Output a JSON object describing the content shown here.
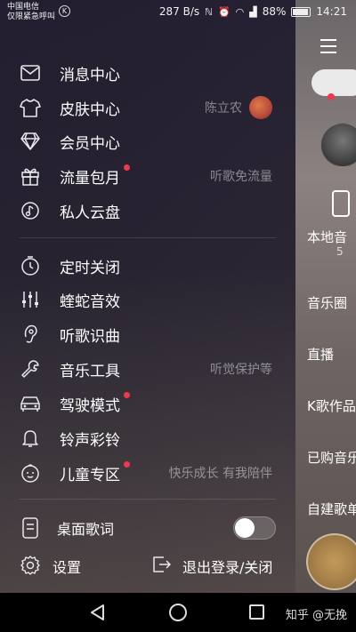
{
  "status_bar": {
    "carrier_line1": "中国电信",
    "carrier_line2": "仅限紧急呼叫",
    "carrier_badge": "K",
    "speed": "287 B/s",
    "battery": "88%",
    "time": "14:21"
  },
  "menu": {
    "items": [
      {
        "label": "消息中心",
        "icon": "mail-icon",
        "right": ""
      },
      {
        "label": "皮肤中心",
        "icon": "tshirt-icon",
        "right": "陈立农"
      },
      {
        "label": "会员中心",
        "icon": "diamond-icon",
        "right": ""
      },
      {
        "label": "流量包月",
        "icon": "gift-icon",
        "right": "听歌免流量"
      },
      {
        "label": "私人云盘",
        "icon": "cloud-music-icon",
        "right": ""
      },
      {
        "label": "定时关闭",
        "icon": "timer-icon",
        "right": ""
      },
      {
        "label": "蝰蛇音效",
        "icon": "equalizer-icon",
        "right": ""
      },
      {
        "label": "听歌识曲",
        "icon": "mic-icon",
        "right": ""
      },
      {
        "label": "音乐工具",
        "icon": "wrench-icon",
        "right": "听觉保护等"
      },
      {
        "label": "驾驶模式",
        "icon": "car-icon",
        "right": ""
      },
      {
        "label": "铃声彩铃",
        "icon": "bell-icon",
        "right": ""
      },
      {
        "label": "儿童专区",
        "icon": "child-icon",
        "right": "快乐成长 有我陪伴"
      }
    ],
    "desktop_lyrics_label": "桌面歌词",
    "desktop_lyrics_on": false,
    "settings_label": "设置",
    "logout_label": "退出登录/关闭"
  },
  "background": {
    "local_music": "本地音",
    "local_count": "5",
    "music_circle": "音乐圈",
    "live": "直播",
    "k_works": "K歌作品",
    "purchased": "已购音乐",
    "custom_playlist": "自建歌单"
  },
  "nav": {
    "watermark": "知乎 @无挽"
  },
  "colors": {
    "accent_red": "#f0394c"
  }
}
